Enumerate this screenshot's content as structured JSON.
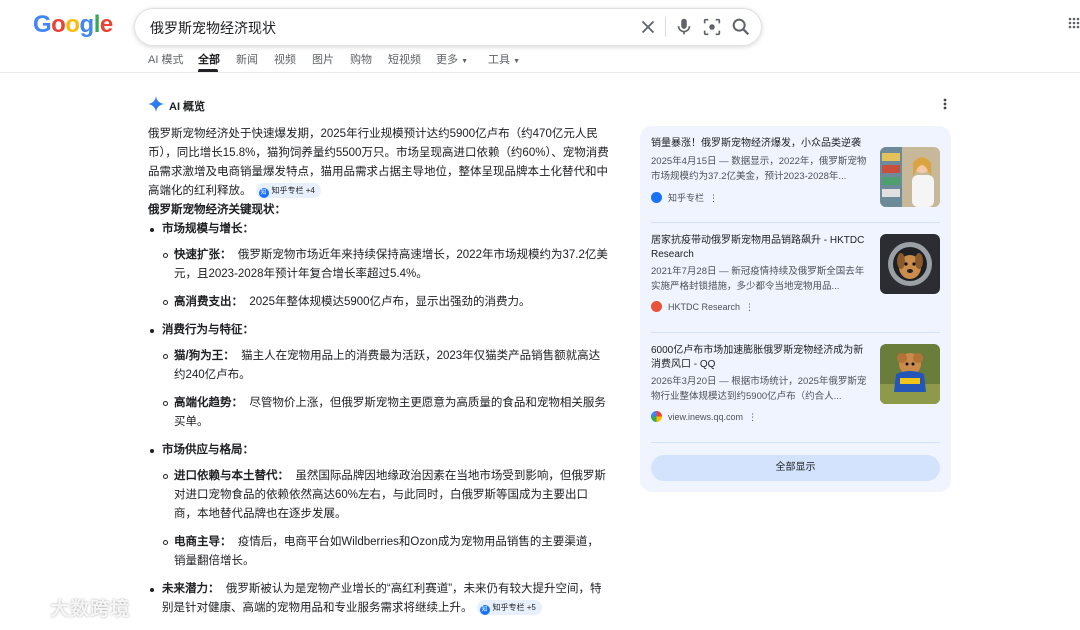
{
  "logo": "Google",
  "search": {
    "query": "俄罗斯宠物经济现状"
  },
  "tabs": [
    "AI 模式",
    "全部",
    "新闻",
    "视频",
    "图片",
    "购物",
    "短视频",
    "更多",
    "工具"
  ],
  "ai_overview": {
    "heading": "AI 概览",
    "intro": "俄罗斯宠物经济处于快速爆发期，2025年行业规模预计达约5900亿卢布（约470亿元人民币），同比增长15.8%，猫狗饲养量约5500万只。市场呈现高进口依赖（约60%）、宠物消费品需求激增及电商销量爆发特点，猫用品需求占据主导地位，整体呈现品牌本土化替代和中高端化的红利释放。",
    "intro_chip": "知乎专栏 +4",
    "section_title": "俄罗斯宠物经济关键现状：",
    "sections": [
      {
        "title": "市场规模与增长：",
        "items": [
          {
            "label": "快速扩张：",
            "text": "俄罗斯宠物市场近年来持续保持高速增长，2022年市场规模约为37.2亿美元，且2023-2028年预计年复合增长率超过5.4%。"
          },
          {
            "label": "高消费支出：",
            "text": "2025年整体规模达5900亿卢布，显示出强劲的消费力。"
          }
        ]
      },
      {
        "title": "消费行为与特征：",
        "items": [
          {
            "label": "猫/狗为王：",
            "text": "猫主人在宠物用品上的消费最为活跃，2023年仅猫类产品销售额就高达约240亿卢布。"
          },
          {
            "label": "高端化趋势：",
            "text": "尽管物价上涨，但俄罗斯宠物主更愿意为高质量的食品和宠物相关服务买单。"
          }
        ]
      },
      {
        "title": "市场供应与格局：",
        "items": [
          {
            "label": "进口依赖与本土替代：",
            "text": "虽然国际品牌因地缘政治因素在当地市场受到影响，但俄罗斯对进口宠物食品的依赖依然高达60%左右，与此同时，白俄罗斯等国成为主要出口商，本地替代品牌也在逐步发展。"
          },
          {
            "label": "电商主导：",
            "text": "疫情后，电商平台如Wildberries和Ozon成为宠物用品销售的主要渠道，销量翻倍增长。"
          }
        ]
      }
    ],
    "potential_label": "未来潜力：",
    "potential_text": "俄罗斯被认为是宠物产业增长的“高红利赛道”，未来仍有较大提升空间，特别是针对健康、高端的宠物用品和专业服务需求将继续上升。",
    "potential_chip": "知乎专栏 +5"
  },
  "sources": [
    {
      "title": "销量暴涨！俄罗斯宠物经济爆发，小众品类逆袭",
      "snippet": "2025年4月15日 — 数据显示，2022年，俄罗斯宠物市场规模约为37.2亿美金，预计2023-2028年...",
      "source": "知乎专栏",
      "icon_color": "#1772f6"
    },
    {
      "title": "居家抗疫带动俄罗斯宠物用品销路飙升 - HKTDC Research",
      "snippet": "2021年7月28日 — 新冠疫情持续及俄罗斯全国去年实施严格封锁措施，多少都令当地宠物用品...",
      "source": "HKTDC Research",
      "icon_color": "#e8533c"
    },
    {
      "title": "6000亿卢布市场加速膨胀俄罗斯宠物经济成为新消费风口 - QQ",
      "snippet": "2026年3月20日 — 根据市场统计，2025年俄罗斯宠物行业整体规模达到约5900亿卢布（约合人...",
      "source": "view.inews.qq.com",
      "icon_color": "#1a73e8"
    }
  ],
  "show_all": "全部显示",
  "watermark": "大数跨境"
}
